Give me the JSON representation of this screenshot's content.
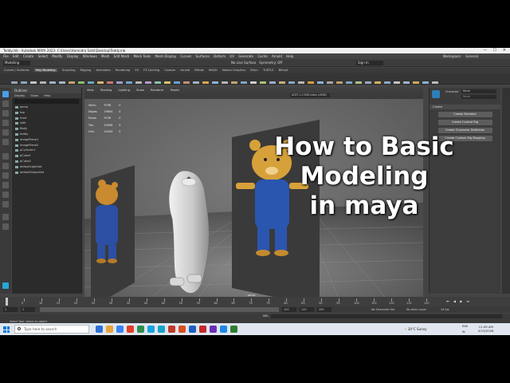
{
  "window": {
    "title": "Teddy.mb - Autodesk MAYA 2023: C:\\Users\\Harendra Sahil\\Desktop\\Teddy.mb",
    "controls": "— ☐ ✕"
  },
  "menubar": {
    "items": [
      "File",
      "Edit",
      "Create",
      "Select",
      "Modify",
      "Display",
      "Windows",
      "Mesh",
      "Edit Mesh",
      "Mesh Tools",
      "Mesh Display",
      "Curves",
      "Surfaces",
      "Deform",
      "UV",
      "Generate",
      "Cache",
      "Arnold",
      "Help"
    ],
    "workspace_label": "Workspace:",
    "workspace_value": "General"
  },
  "statusline": {
    "mode": "Modeling",
    "no_live_surface": "No Live Surface",
    "symmetry": "Symmetry: Off",
    "login": "Sign In"
  },
  "shelf": {
    "tabs": [
      "Curves / Surfaces",
      "Poly Modeling",
      "Sculpting",
      "Rigging",
      "Animation",
      "Rendering",
      "FX",
      "FX Caching",
      "Custom",
      "Arnold",
      "Bifrost",
      "MASH",
      "Motion Graphics",
      "XGen",
      "TURTLE",
      "Bifrost"
    ],
    "active_tab": "Poly Modeling",
    "icon_colors": [
      "#9aa5b5",
      "#8fa6c2",
      "#c7c7c7",
      "#b4b4b4",
      "#9fb3c9",
      "#a8b8c8",
      "#c5a46a",
      "#8fbf6a",
      "#6aa6c6",
      "#d9b86e",
      "#c97a6e",
      "#9f9fd0",
      "#6fa6d3",
      "#b7b7b7",
      "#b39ad0",
      "#8ec0a8",
      "#d8c36a",
      "#6ea2d4",
      "#c7907a",
      "#a0b4c2",
      "#d7a94d",
      "#8ab5d9",
      "#b6b6b6",
      "#c4a56d",
      "#7ea7c8",
      "#d0d0d0",
      "#a9c27e",
      "#9bb0c7",
      "#c9b17a",
      "#86a8c5",
      "#b8b8b8",
      "#d8a040",
      "#8eb4d6",
      "#a7a7a7",
      "#c3a06a",
      "#7fa3c4",
      "#b0c18a",
      "#9aaac0",
      "#d4b45e",
      "#8aa9cc",
      "#c4c4c4",
      "#a3b3c8",
      "#d2ab58",
      "#8db1d1",
      "#bcbcbc"
    ]
  },
  "outliner": {
    "title": "Outliner",
    "menu": [
      "Display",
      "Show",
      "Help"
    ],
    "items": [
      "persp",
      "top",
      "front",
      "side",
      "Body",
      "teddy",
      "imagePlane1",
      "imagePlane2",
      "pCylinder1",
      "pCube1",
      "pCube2",
      "defaultLightSet",
      "defaultObjectSet"
    ]
  },
  "viewport": {
    "menu": [
      "View",
      "Shading",
      "Lighting",
      "Show",
      "Renderer",
      "Panels"
    ],
    "colorspace": "ACES 1.0 SDR-video (sRGB)",
    "hud": [
      {
        "label": "Verts:",
        "a": "9798",
        "b": "0"
      },
      {
        "label": "Edges:",
        "a": "19604",
        "b": "0"
      },
      {
        "label": "Faces:",
        "a": "9728",
        "b": "0"
      },
      {
        "label": "Tris:",
        "a": "19456",
        "b": "0"
      },
      {
        "label": "UVs:",
        "a": "10434",
        "b": "0"
      }
    ],
    "camera_label": "persp"
  },
  "caption": {
    "line1": "How to Basic",
    "line2": "Modeling",
    "line3": "in maya"
  },
  "character_panel": {
    "character_label": "Character",
    "character_value": "None",
    "source_label": "Source",
    "source_value": "None",
    "section": "Create",
    "buttons": [
      "Create Skeleton",
      "Create Control Rig",
      "Create Character Definition",
      "Create Custom Rig Mapping"
    ]
  },
  "timeslider": {
    "ticks": [
      "5",
      "10",
      "15",
      "20",
      "25",
      "30",
      "35",
      "40",
      "45",
      "50",
      "55",
      "60",
      "65",
      "70",
      "75",
      "80",
      "85",
      "90",
      "95",
      "100",
      "105",
      "110",
      "115",
      "120"
    ],
    "current_frame": "1",
    "controls": "⏮ ◀ ▶ ⏭"
  },
  "range": {
    "start": "1",
    "inner_start": "1",
    "inner_end": "120",
    "end": "120",
    "end2": "200",
    "character_set": "No Character Set",
    "anim_layer": "No Anim Layer",
    "fps": "24 fps"
  },
  "cmdline": {
    "mel": "MEL",
    "help": "Select Tool: select an object"
  },
  "taskbar": {
    "search_placeholder": "Type here to search",
    "app_colors": [
      "#2f6fd1",
      "#e8a33b",
      "#3b82f6",
      "#e33d2a",
      "#2f8f4e",
      "#1ba1e2",
      "#16a3c9",
      "#c0392b",
      "#d94f1e",
      "#1f5fbf",
      "#c62828",
      "#6b2fb3",
      "#1e88e5",
      "#2e7d32"
    ],
    "weather": "34°C Sunny",
    "lang": "ENG",
    "lang2": "IN",
    "time": "11:49 AM",
    "date": "5/13/2026"
  }
}
